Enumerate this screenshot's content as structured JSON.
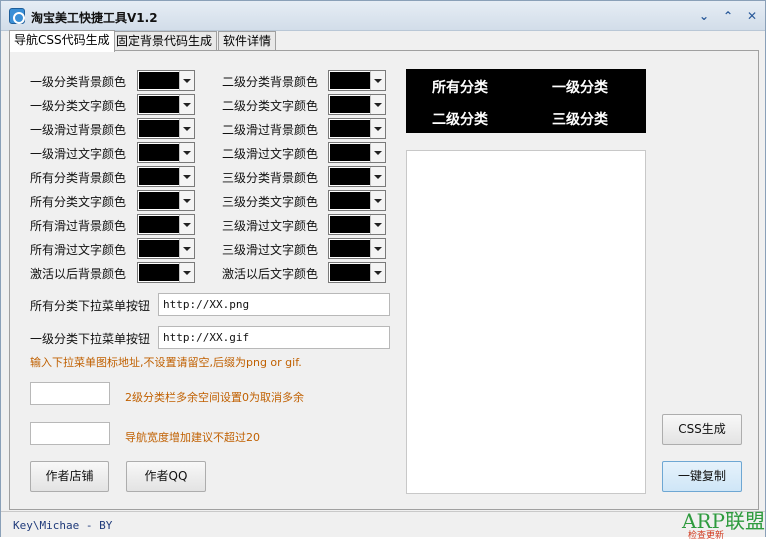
{
  "window": {
    "title": "淘宝美工快捷工具V1.2",
    "controls": {
      "collapse": "⌄",
      "expand": "⌃",
      "close": "✕"
    }
  },
  "tabs": [
    {
      "label": "导航CSS代码生成",
      "active": true
    },
    {
      "label": "固定背景代码生成",
      "active": false
    },
    {
      "label": "软件详情",
      "active": false
    }
  ],
  "colors": {
    "swatch": "#000000",
    "preview_background": "#000000",
    "preview_text": "#ffffff",
    "hint_text": "#c06000"
  },
  "color_fields_left": [
    "一级分类背景颜色",
    "一级分类文字颜色",
    "一级滑过背景颜色",
    "一级滑过文字颜色",
    "所有分类背景颜色",
    "所有分类文字颜色",
    "所有滑过背景颜色",
    "所有滑过文字颜色",
    "激活以后背景颜色"
  ],
  "color_fields_right": [
    "二级分类背景颜色",
    "二级分类文字颜色",
    "二级滑过背景颜色",
    "二级滑过文字颜色",
    "三级分类背景颜色",
    "三级分类文字颜色",
    "三级滑过文字颜色",
    "三级滑过文字颜色",
    "激活以后文字颜色"
  ],
  "dropdown_buttons": {
    "all_label": "所有分类下拉菜单按钮",
    "all_value": "http://XX.png",
    "level1_label": "一级分类下拉菜单按钮",
    "level1_value": "http://XX.gif",
    "hint": "输入下拉菜单图标地址,不设置请留空,后缀为png or gif."
  },
  "settings": {
    "spare_space_value": "",
    "spare_space_hint": "2级分类栏多余空间设置0为取消多余",
    "nav_width_value": "",
    "nav_width_hint": "导航宽度增加建议不超过20"
  },
  "buttons": {
    "author_shop": "作者店铺",
    "author_qq": "作者QQ",
    "css_generate": "CSS生成",
    "copy": "一键复制"
  },
  "preview": {
    "items": [
      "所有分类",
      "一级分类",
      "二级分类",
      "三级分类"
    ]
  },
  "status": {
    "text": "Key\\Michae - BY"
  },
  "watermark": {
    "main": "ARP联盟",
    "sub": "检查更新"
  }
}
